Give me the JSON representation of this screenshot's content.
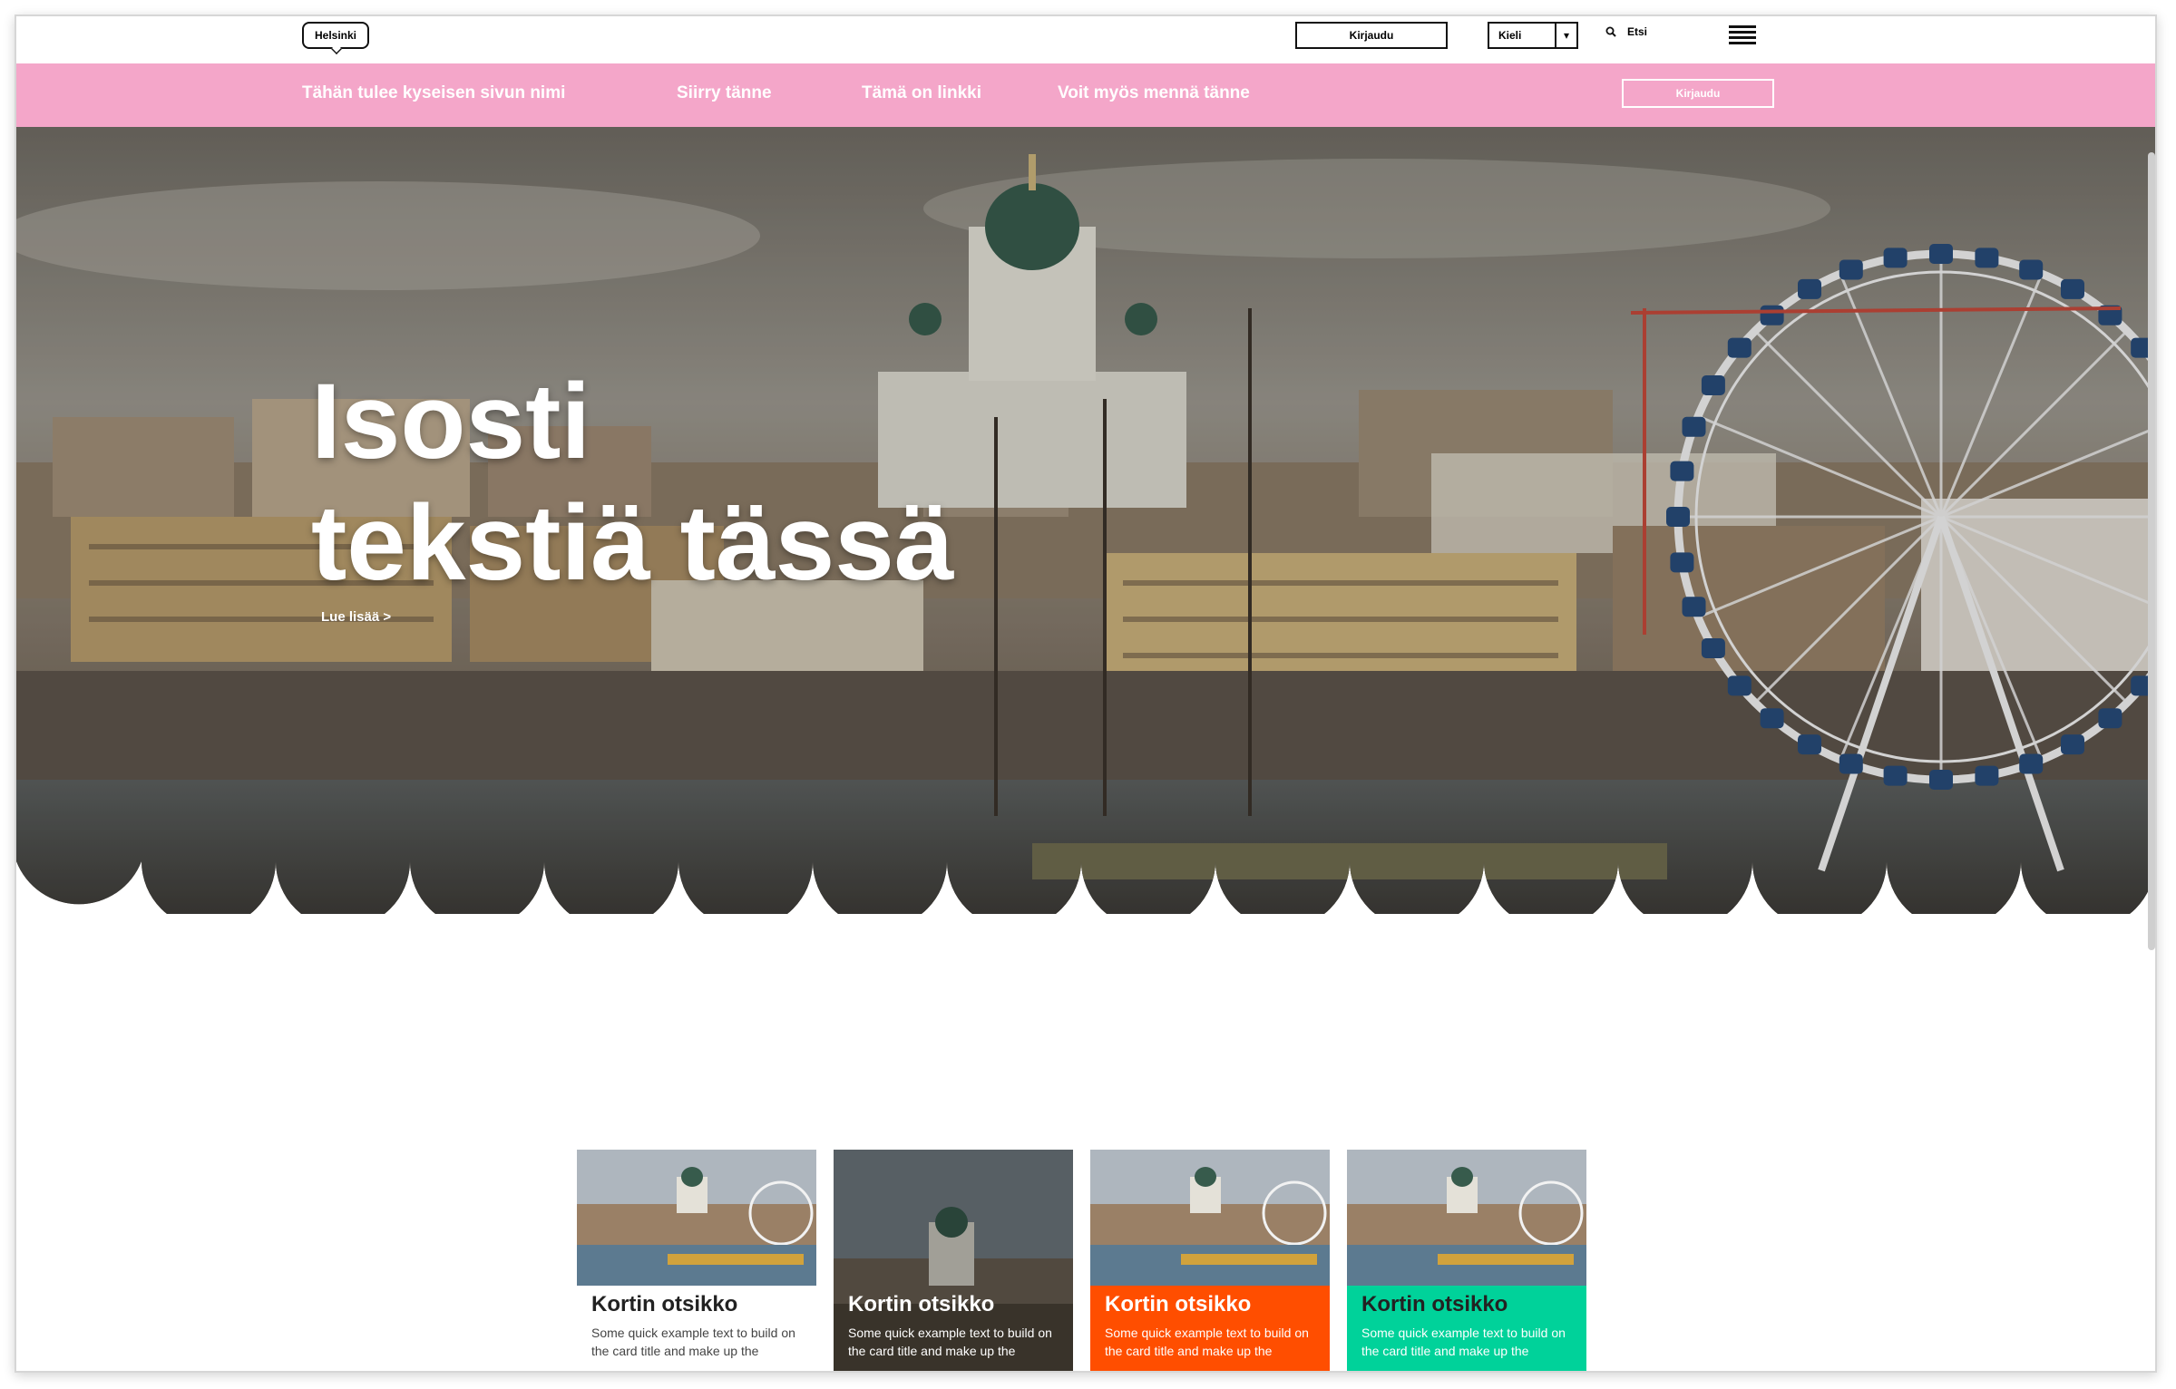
{
  "header": {
    "logo_text": "Helsinki",
    "login_label": "Kirjaudu",
    "language": {
      "label": "Kieli",
      "caret": "▾"
    },
    "search_label": "Etsi",
    "search_icon": "search-icon",
    "menu_icon": "hamburger-menu-icon"
  },
  "nav": {
    "items": [
      {
        "label": "Tähän tulee kyseisen sivun nimi"
      },
      {
        "label": "Siirry tänne"
      },
      {
        "label": "Tämä on linkki"
      },
      {
        "label": "Voit myös mennä tänne"
      }
    ],
    "login_label": "Kirjaudu",
    "background": "#f4a6c9"
  },
  "hero": {
    "title_line1": "Isosti",
    "title_line2": "tekstiä tässä",
    "read_more": "Lue lisää >"
  },
  "cards": [
    {
      "title": "Kortin otsikko",
      "text": "Some quick example text to build on the card title and make up the",
      "style": "white"
    },
    {
      "title": "Kortin otsikko",
      "text": "Some quick example text to build on the card title and make up the",
      "style": "dark"
    },
    {
      "title": "Kortin otsikko",
      "text": "Some quick example text to build on the card title and make up the",
      "style": "orange",
      "color": "#ff4e00"
    },
    {
      "title": "Kortin otsikko",
      "text": "Some quick example text to build on the card title and make up the",
      "style": "teal",
      "color": "#00d29a"
    }
  ]
}
